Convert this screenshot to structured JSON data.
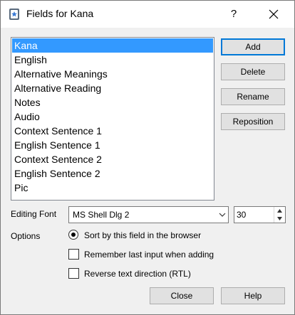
{
  "window": {
    "title": "Fields for Kana",
    "help_symbol": "?",
    "app_icon": "anki-icon",
    "close_icon": "close-icon"
  },
  "fields": [
    {
      "label": "Kana",
      "selected": true
    },
    {
      "label": "English",
      "selected": false
    },
    {
      "label": "Alternative Meanings",
      "selected": false
    },
    {
      "label": "Alternative Reading",
      "selected": false
    },
    {
      "label": "Notes",
      "selected": false
    },
    {
      "label": "Audio",
      "selected": false
    },
    {
      "label": "Context Sentence 1",
      "selected": false
    },
    {
      "label": "English Sentence 1",
      "selected": false
    },
    {
      "label": "Context Sentence 2",
      "selected": false
    },
    {
      "label": "English Sentence 2",
      "selected": false
    },
    {
      "label": "Pic",
      "selected": false
    }
  ],
  "side_buttons": {
    "add": "Add",
    "delete": "Delete",
    "rename": "Rename",
    "reposition": "Reposition"
  },
  "editing_font": {
    "label": "Editing Font",
    "font_value": "MS Shell Dlg 2",
    "size_value": "30"
  },
  "options": {
    "label": "Options",
    "sort_field": {
      "label": "Sort by this field in the browser",
      "checked": true
    },
    "remember_last": {
      "label": "Remember last input when adding",
      "checked": false
    },
    "rtl": {
      "label": "Reverse text direction (RTL)",
      "checked": false
    }
  },
  "footer": {
    "close": "Close",
    "help": "Help"
  },
  "colors": {
    "selection": "#3399ff",
    "default_button_border": "#0078d7",
    "dialog_bg": "#f0f0f0"
  }
}
